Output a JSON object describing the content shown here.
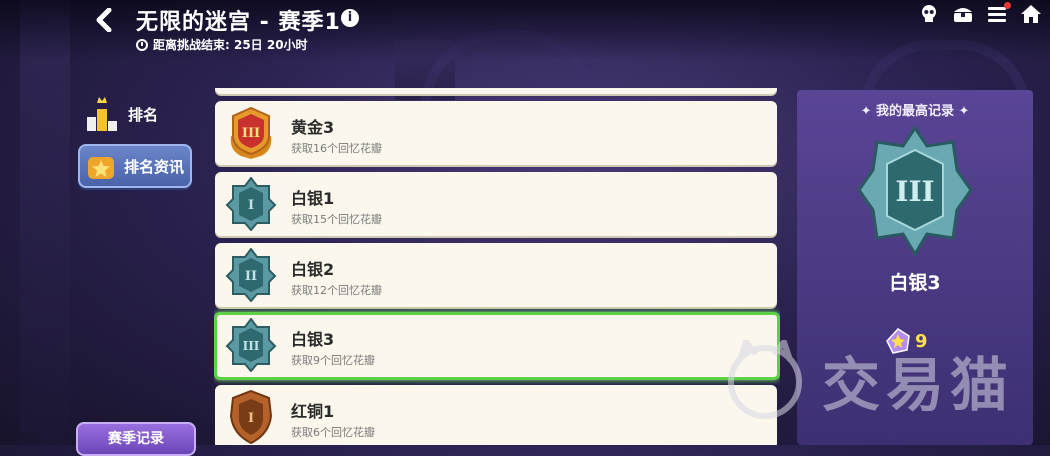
{
  "header": {
    "title": "无限的迷宫 - 赛季1",
    "info_glyph": "i",
    "countdown": "距离挑战结束: 25日 20小时"
  },
  "top_icons": [
    "skull-icon",
    "chest-icon",
    "menu-icon",
    "home-icon"
  ],
  "sidebar": {
    "items": [
      {
        "label": "排名",
        "icon": "trophy-bars-icon",
        "active": false
      },
      {
        "label": "排名资讯",
        "icon": "star-crown-icon",
        "active": true
      }
    ],
    "season_button": "赛季记录"
  },
  "ranks": [
    {
      "name": "黄金3",
      "requirement": "获取16个回忆花瓣",
      "tier": "gold",
      "level": "III",
      "selected": false
    },
    {
      "name": "白银1",
      "requirement": "获取15个回忆花瓣",
      "tier": "silver",
      "level": "I",
      "selected": false
    },
    {
      "name": "白银2",
      "requirement": "获取12个回忆花瓣",
      "tier": "silver",
      "level": "II",
      "selected": false
    },
    {
      "name": "白银3",
      "requirement": "获取9个回忆花瓣",
      "tier": "silver",
      "level": "III",
      "selected": true
    },
    {
      "name": "红铜1",
      "requirement": "获取6个回忆花瓣",
      "tier": "bronze",
      "level": "I",
      "selected": false
    }
  ],
  "best_record": {
    "title": "✦ 我的最高记录 ✦",
    "rank_name": "白银3",
    "level": "III",
    "petal_count": "9"
  },
  "watermark": "交易猫",
  "colors": {
    "gold": "#d8871c",
    "silver": "#4f8c95",
    "bronze": "#b5612a",
    "selected_border": "#5fd04a",
    "accent_yellow": "#ffe14a"
  }
}
